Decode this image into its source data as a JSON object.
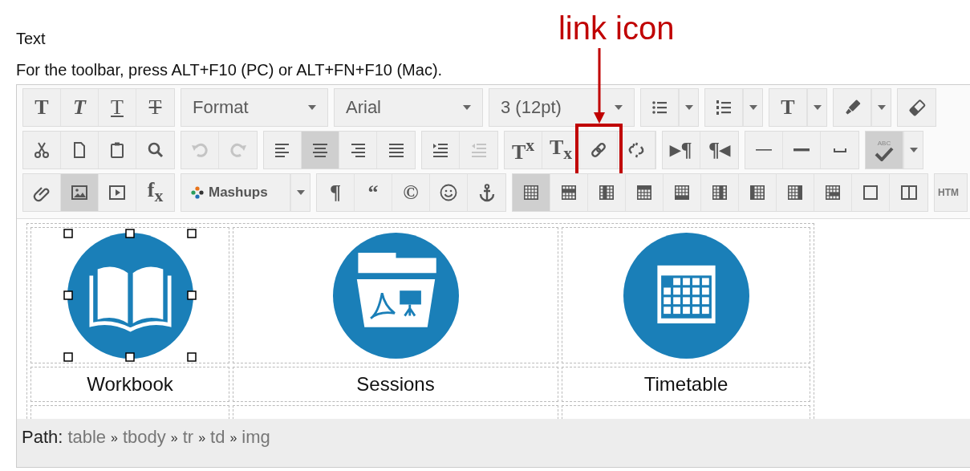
{
  "heading": "Text",
  "instructions": "For the toolbar, press ALT+F10 (PC) or ALT+FN+F10 (Mac).",
  "annotation": {
    "label": "link icon"
  },
  "toolbar": {
    "rows": [
      {
        "groups": [
          {
            "items": [
              {
                "kind": "bold",
                "text": "T",
                "pressed": false,
                "disabled": false
              },
              {
                "kind": "italic",
                "text": "T",
                "pressed": false,
                "disabled": false
              },
              {
                "kind": "underline",
                "text": "T",
                "pressed": false,
                "disabled": false
              },
              {
                "kind": "strike",
                "text": "T",
                "pressed": false,
                "disabled": false
              }
            ]
          },
          {
            "items": [
              {
                "kind": "select",
                "label": "Format"
              }
            ]
          },
          {
            "items": [
              {
                "kind": "select",
                "label": "Arial"
              }
            ]
          },
          {
            "items": [
              {
                "kind": "select",
                "label": "3 (12pt)"
              }
            ]
          },
          {
            "items": [
              {
                "kind": "icon",
                "pressed": false,
                "disabled": false
              },
              {
                "kind": "caret"
              }
            ]
          },
          {
            "items": [
              {
                "kind": "icon",
                "pressed": false,
                "disabled": false
              },
              {
                "kind": "caret"
              }
            ]
          },
          {
            "items": [
              {
                "kind": "glyph",
                "text": "T",
                "pressed": false,
                "disabled": false
              },
              {
                "kind": "caret"
              }
            ]
          },
          {
            "items": [
              {
                "kind": "icon",
                "pressed": false,
                "disabled": false
              },
              {
                "kind": "caret"
              }
            ]
          },
          {
            "items": [
              {
                "kind": "icon",
                "pressed": false,
                "disabled": false
              }
            ]
          }
        ]
      },
      {
        "groups": [
          {
            "items": [
              {
                "kind": "icon",
                "pressed": false,
                "disabled": false
              },
              {
                "kind": "icon",
                "pressed": false,
                "disabled": false
              },
              {
                "kind": "icon",
                "pressed": false,
                "disabled": false
              },
              {
                "kind": "icon",
                "pressed": false,
                "disabled": false
              }
            ]
          },
          {
            "items": [
              {
                "kind": "icon",
                "pressed": false,
                "disabled": true
              },
              {
                "kind": "icon",
                "pressed": false,
                "disabled": true
              }
            ]
          },
          {
            "items": [
              {
                "kind": "icon",
                "pressed": false,
                "disabled": false
              },
              {
                "kind": "icon",
                "pressed": true,
                "disabled": false
              },
              {
                "kind": "icon",
                "pressed": false,
                "disabled": false
              },
              {
                "kind": "icon",
                "pressed": false,
                "disabled": false
              }
            ]
          },
          {
            "items": [
              {
                "kind": "icon",
                "pressed": false,
                "disabled": false
              },
              {
                "kind": "icon",
                "pressed": false,
                "disabled": true
              }
            ]
          },
          {
            "items": [
              {
                "kind": "glyph",
                "text": "T$^{x}$",
                "pressed": false,
                "disabled": false
              },
              {
                "kind": "glyph",
                "text": "T$_{x}$",
                "pressed": false,
                "disabled": false
              },
              {
                "kind": "icon",
                "pressed": false,
                "disabled": false
              },
              {
                "kind": "icon",
                "pressed": false,
                "disabled": false
              }
            ]
          },
          {
            "items": [
              {
                "kind": "glyph",
                "text": "▸¶",
                "pressed": false,
                "disabled": false
              },
              {
                "kind": "glyph",
                "text": "¶◂",
                "pressed": false,
                "disabled": false
              }
            ]
          },
          {
            "items": [
              {
                "kind": "icon",
                "pressed": false,
                "disabled": false
              },
              {
                "kind": "icon",
                "pressed": false,
                "disabled": false
              },
              {
                "kind": "icon",
                "pressed": false,
                "disabled": false
              }
            ]
          },
          {
            "items": [
              {
                "kind": "spell",
                "text": "ABC",
                "pressed": true,
                "disabled": false
              },
              {
                "kind": "caret"
              }
            ]
          }
        ]
      },
      {
        "groups": [
          {
            "items": [
              {
                "kind": "icon",
                "pressed": false,
                "disabled": false
              },
              {
                "kind": "icon",
                "pressed": true,
                "disabled": false
              },
              {
                "kind": "icon",
                "pressed": false,
                "disabled": false
              },
              {
                "kind": "glyph",
                "text": "f$_{x}$",
                "pressed": false,
                "disabled": false
              }
            ]
          },
          {
            "items": [
              {
                "kind": "menu",
                "label": "Mashups"
              },
              {
                "kind": "caret"
              }
            ]
          },
          {
            "items": [
              {
                "kind": "glyph",
                "text": "¶",
                "pressed": false,
                "disabled": false
              },
              {
                "kind": "glyph",
                "text": "“",
                "pressed": false,
                "disabled": false
              },
              {
                "kind": "glyph",
                "text": "©",
                "pressed": false,
                "disabled": false
              },
              {
                "kind": "icon",
                "pressed": false,
                "disabled": false
              },
              {
                "kind": "icon",
                "pressed": false,
                "disabled": false
              }
            ]
          },
          {
            "items": [
              {
                "kind": "icon",
                "pressed": true,
                "disabled": false
              },
              {
                "kind": "icon",
                "pressed": false,
                "disabled": false
              },
              {
                "kind": "icon",
                "pressed": false,
                "disabled": false
              },
              {
                "kind": "icon",
                "pressed": false,
                "disabled": false
              },
              {
                "kind": "icon",
                "pressed": false,
                "disabled": false
              },
              {
                "kind": "icon",
                "pressed": false,
                "disabled": false
              },
              {
                "kind": "icon",
                "pressed": false,
                "disabled": false
              },
              {
                "kind": "icon",
                "pressed": false,
                "disabled": false
              },
              {
                "kind": "icon",
                "pressed": false,
                "disabled": false
              },
              {
                "kind": "icon",
                "pressed": false,
                "disabled": false
              },
              {
                "kind": "icon",
                "pressed": false,
                "disabled": false
              }
            ]
          },
          {
            "items": [
              {
                "kind": "small",
                "text": "HTM",
                "pressed": false,
                "disabled": false
              }
            ]
          }
        ]
      }
    ]
  },
  "content": {
    "cells": [
      {
        "label": "Workbook",
        "selected": true
      },
      {
        "label": "Sessions",
        "selected": false
      },
      {
        "label": "Timetable",
        "selected": false
      }
    ]
  },
  "path_bar": {
    "label": "Path:",
    "parts": [
      {
        "kind": "crumb",
        "text": "table"
      },
      {
        "kind": "separator",
        "text": "»"
      },
      {
        "kind": "crumb",
        "text": "tbody"
      },
      {
        "kind": "separator",
        "text": "»"
      },
      {
        "kind": "crumb",
        "text": "tr"
      },
      {
        "kind": "separator",
        "text": "»"
      },
      {
        "kind": "crumb",
        "text": "td"
      },
      {
        "kind": "separator",
        "text": "»"
      },
      {
        "kind": "crumb",
        "text": "img"
      }
    ]
  }
}
